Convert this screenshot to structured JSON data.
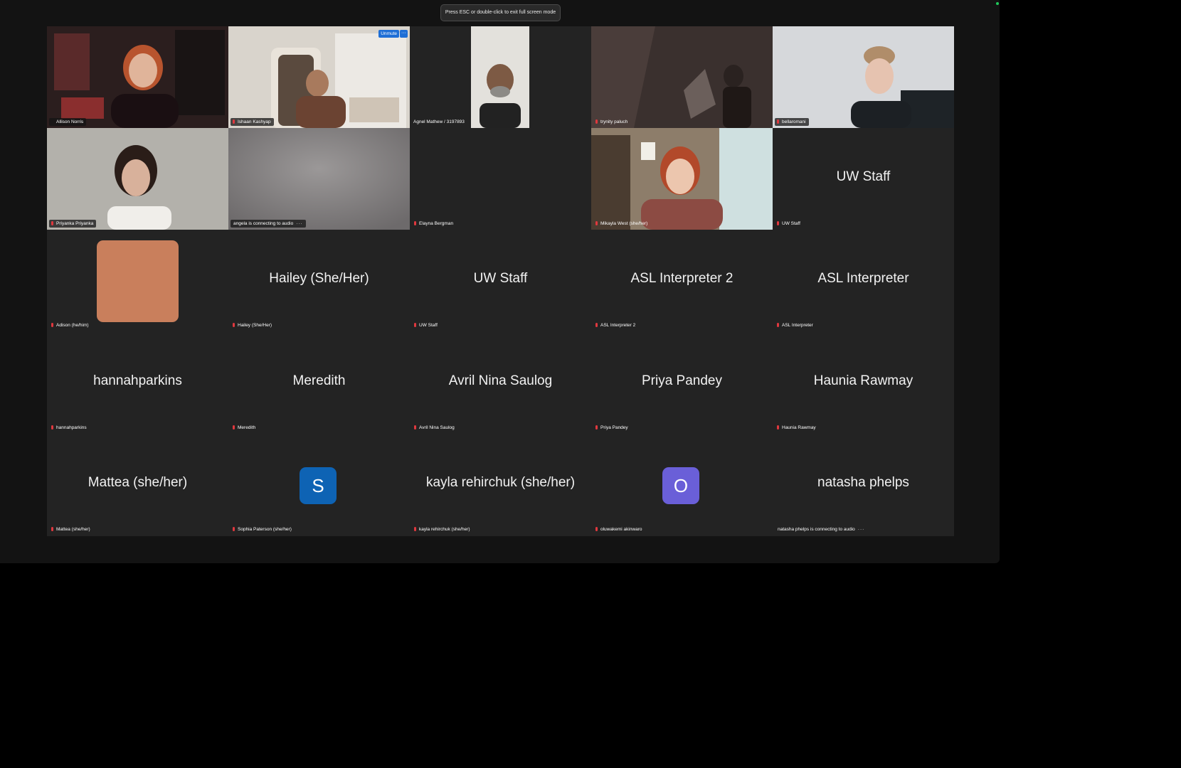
{
  "banner": {
    "text": "Press ESC or double-click to exit full screen mode"
  },
  "tiles": {
    "t1": {
      "name": "Allison Norris"
    },
    "t2": {
      "name": "Ishaan Kashyap",
      "unmute": "Unmute",
      "more": "···"
    },
    "t3": {
      "name": "Agnel Mathew / 3197893"
    },
    "t4": {
      "name": "trynity paluch"
    },
    "t5": {
      "name": "bellaromani"
    },
    "t6": {
      "name": "Priyanka Priyanka"
    },
    "t7": {
      "name": "angela is connecting to audio",
      "dots": "···"
    },
    "t8": {
      "name": "Elayna Bergman"
    },
    "t9": {
      "name": "Mikayla West (she/her)"
    },
    "t10": {
      "display": "UW Staff",
      "name": "UW Staff"
    },
    "t11": {
      "name": "Adison (he/him)"
    },
    "t12": {
      "display": "Hailey (She/Her)",
      "name": "Hailey (She/Her)"
    },
    "t13": {
      "display": "UW Staff",
      "name": "UW Staff"
    },
    "t14": {
      "display": "ASL Interpreter 2",
      "name": "ASL Interpreter 2"
    },
    "t15": {
      "display": "ASL Interpreter",
      "name": "ASL Interpreter"
    },
    "t16": {
      "display": "hannahparkins",
      "name": "hannahparkins"
    },
    "t17": {
      "display": "Meredith",
      "name": "Meredith"
    },
    "t18": {
      "display": "Avril Nina Saulog",
      "name": "Avril Nina Saulog"
    },
    "t19": {
      "display": "Priya Pandey",
      "name": "Priya Pandey"
    },
    "t20": {
      "display": "Haunia Rawmay",
      "name": "Haunia Rawmay"
    },
    "t21": {
      "display": "Mattea (she/her)",
      "name": "Mattea (she/her)"
    },
    "t22": {
      "initial": "S",
      "name": "Sophia Paterson (she/her)"
    },
    "t23": {
      "display": "kayla rehirchuk (she/her)",
      "name": "kayla rehirchuk (she/her)"
    },
    "t24": {
      "initial": "O",
      "name": "oluwakemi akinwaro"
    },
    "t25": {
      "display": "natasha phelps",
      "name": "natasha phelps is connecting to audio",
      "dots": "···"
    }
  },
  "colors": {
    "active_speaker": "#3ec15e",
    "muted_mic": "#e0383e",
    "avatar_s": "#0e63b4",
    "avatar_o": "#6a5fd8",
    "avatar_adison": "#c97f5c"
  }
}
